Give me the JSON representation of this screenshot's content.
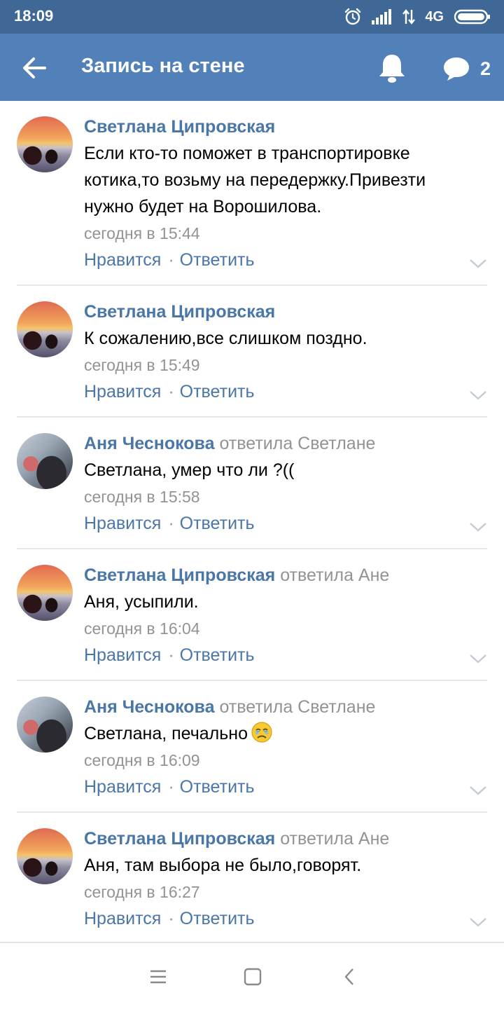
{
  "statusbar": {
    "time": "18:09",
    "network": "4G"
  },
  "appbar": {
    "title": "Запись на стене",
    "comments_count": "2"
  },
  "comments": [
    {
      "author": "Светлана Ципровская",
      "reply_to": "",
      "text": "Если кто-то поможет в транспортировке котика,то возьму на передержку.Привезти нужно будет на Ворошилова.",
      "time": "сегодня в 15:44",
      "like": "Нравится",
      "reply": "Ответить"
    },
    {
      "author": "Светлана Ципровская",
      "reply_to": "",
      "text": "К сожалению,все слишком поздно.",
      "time": "сегодня в 15:49",
      "like": "Нравится",
      "reply": "Ответить"
    },
    {
      "author": "Аня Чеснокова",
      "reply_to": "ответила Светлане",
      "text": "Светлана, умер что ли ?((",
      "time": "сегодня в 15:58",
      "like": "Нравится",
      "reply": "Ответить"
    },
    {
      "author": "Светлана Ципровская",
      "reply_to": "ответила Ане",
      "text": "Аня, усыпили.",
      "time": "сегодня в 16:04",
      "like": "Нравится",
      "reply": "Ответить"
    },
    {
      "author": "Аня Чеснокова",
      "reply_to": "ответила Светлане",
      "text": "Светлана, печально",
      "emoji": "crying-face-emoji",
      "time": "сегодня в 16:09",
      "like": "Нравится",
      "reply": "Ответить"
    },
    {
      "author": "Светлана Ципровская",
      "reply_to": "ответила Ане",
      "text": "Аня, там выбора не было,говорят.",
      "time": "сегодня в 16:27",
      "like": "Нравится",
      "reply": "Ответить"
    }
  ],
  "separator": "·",
  "colors": {
    "statusbar": "#3f6896",
    "appbar": "#5181b8",
    "link": "#4a76a8",
    "muted": "#939393",
    "divider": "#e5e8ed"
  },
  "icons": {
    "back": "arrow-left-icon",
    "bell": "bell-icon",
    "comments": "speech-bubble-icon",
    "expand": "chevron-down-icon",
    "nav_menu": "menu-icon",
    "nav_home": "square-icon",
    "nav_back": "back-triangle-icon"
  }
}
